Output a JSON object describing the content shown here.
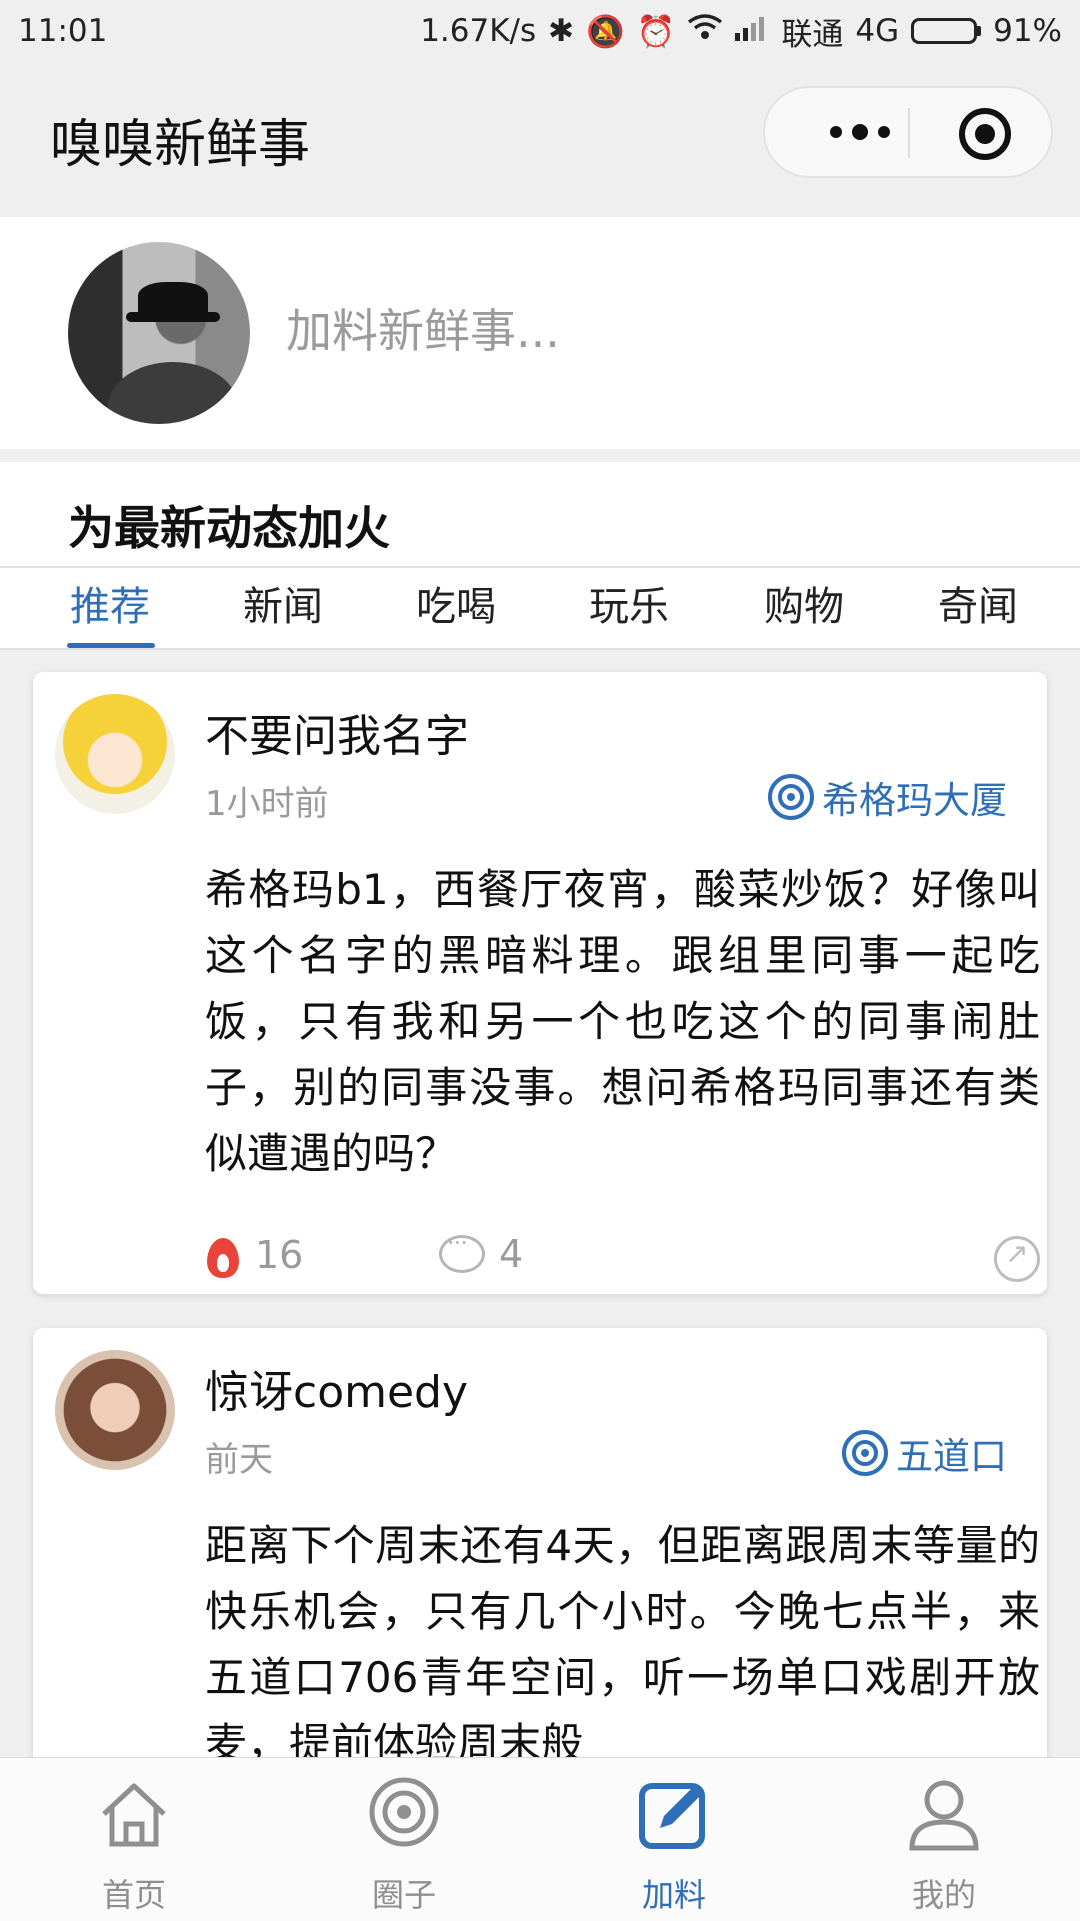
{
  "status_bar": {
    "time": "11:01",
    "net_speed": "1.67K/s",
    "carrier": "联通",
    "network": "4G",
    "battery": "91%",
    "battery_level": 0.91,
    "icons": [
      "bluetooth-icon",
      "mute-icon",
      "alarm-icon",
      "wifi-icon",
      "signal-icon",
      "battery-icon"
    ]
  },
  "header": {
    "title": "嗅嗅新鲜事",
    "capsule_icons": [
      "more-icon",
      "close-target-icon"
    ]
  },
  "compose": {
    "placeholder": "加料新鲜事..."
  },
  "section": {
    "title": "为最新动态加火",
    "tabs": [
      {
        "label": "推荐",
        "active": true
      },
      {
        "label": "新闻",
        "active": false
      },
      {
        "label": "吃喝",
        "active": false
      },
      {
        "label": "玩乐",
        "active": false
      },
      {
        "label": "购物",
        "active": false
      },
      {
        "label": "奇闻",
        "active": false
      }
    ]
  },
  "feed": [
    {
      "user": "不要问我名字",
      "time": "1小时前",
      "location": "希格玛大厦",
      "text": "希格玛b1，西餐厅夜宵，酸菜炒饭？好像叫这个名字的黑暗料理。跟组里同事一起吃饭，只有我和另一个也吃这个的同事闹肚子，别的同事没事。想问希格玛同事还有类似遭遇的吗？",
      "fire": "16",
      "comments": "4"
    },
    {
      "user": "惊讶comedy",
      "time": "前天",
      "location": "五道口",
      "text": "距离下个周末还有4天，但距离跟周末等量的快乐机会，只有几个小时。今晚七点半，来五道口706青年空间，听一场单口戏剧开放麦，提前体验周末般"
    }
  ],
  "tabbar": [
    {
      "label": "首页",
      "icon": "home-icon",
      "active": false
    },
    {
      "label": "圈子",
      "icon": "circle-icon",
      "active": false
    },
    {
      "label": "加料",
      "icon": "edit-icon",
      "active": true
    },
    {
      "label": "我的",
      "icon": "user-icon",
      "active": false
    }
  ],
  "colors": {
    "accent": "#2e6fb7",
    "fire": "#e8443a",
    "muted": "#9a9a9a"
  }
}
